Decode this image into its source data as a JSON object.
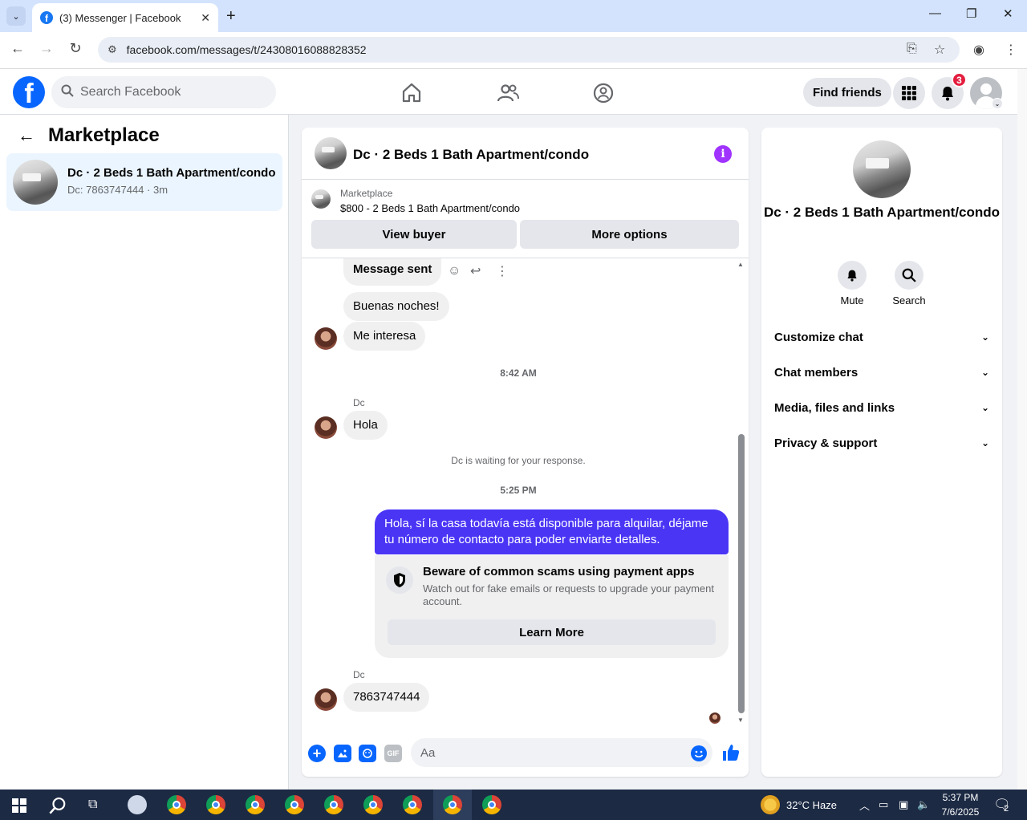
{
  "browser": {
    "tab_title": "(3) Messenger | Facebook",
    "url": "facebook.com/messages/t/24308016088828352"
  },
  "fb_header": {
    "search_placeholder": "Search Facebook",
    "find_friends": "Find friends",
    "notification_count": "3"
  },
  "left_panel": {
    "title": "Marketplace",
    "conversation": {
      "name": "Dc · 2 Beds 1 Bath Apartment/condo",
      "sub": "Dc: 7863747444 · 3m"
    }
  },
  "chat": {
    "title": "Dc · 2 Beds 1 Bath Apartment/condo",
    "marketplace_label": "Marketplace",
    "listing": "$800 - 2 Beds 1 Bath Apartment/condo",
    "view_buyer": "View buyer",
    "more_options": "More options",
    "messages": {
      "m1": "Message sent",
      "m2": "Buenas noches!",
      "m3": "Me interesa",
      "time1": "8:42 AM",
      "sender1": "Dc",
      "m4": "Hola",
      "waiting": "Dc is waiting for your response.",
      "time2": "5:25 PM",
      "m5": "Hola, sí la casa todavía está disponible para alquilar, déjame tu número de contacto para poder enviarte detalles.",
      "sender2": "Dc",
      "m6": "7863747444"
    },
    "scam": {
      "heading": "Beware of common scams using payment apps",
      "body": "Watch out for fake emails or requests to upgrade your payment account.",
      "learn_more": "Learn More"
    },
    "composer_placeholder": "Aa"
  },
  "right_panel": {
    "title": "Dc · 2 Beds 1 Bath Apartment/condo",
    "mute": "Mute",
    "search": "Search",
    "rows": [
      "Customize chat",
      "Chat members",
      "Media, files and links",
      "Privacy & support"
    ]
  },
  "taskbar": {
    "weather": "32°C  Haze",
    "time": "5:37 PM",
    "date": "7/6/2025",
    "notif_count": "2"
  },
  "colors": {
    "fb_blue": "#0866ff",
    "my_bubble": "#4a35f5",
    "info_purple": "#a033ff",
    "badge_red": "#e41e3f"
  }
}
